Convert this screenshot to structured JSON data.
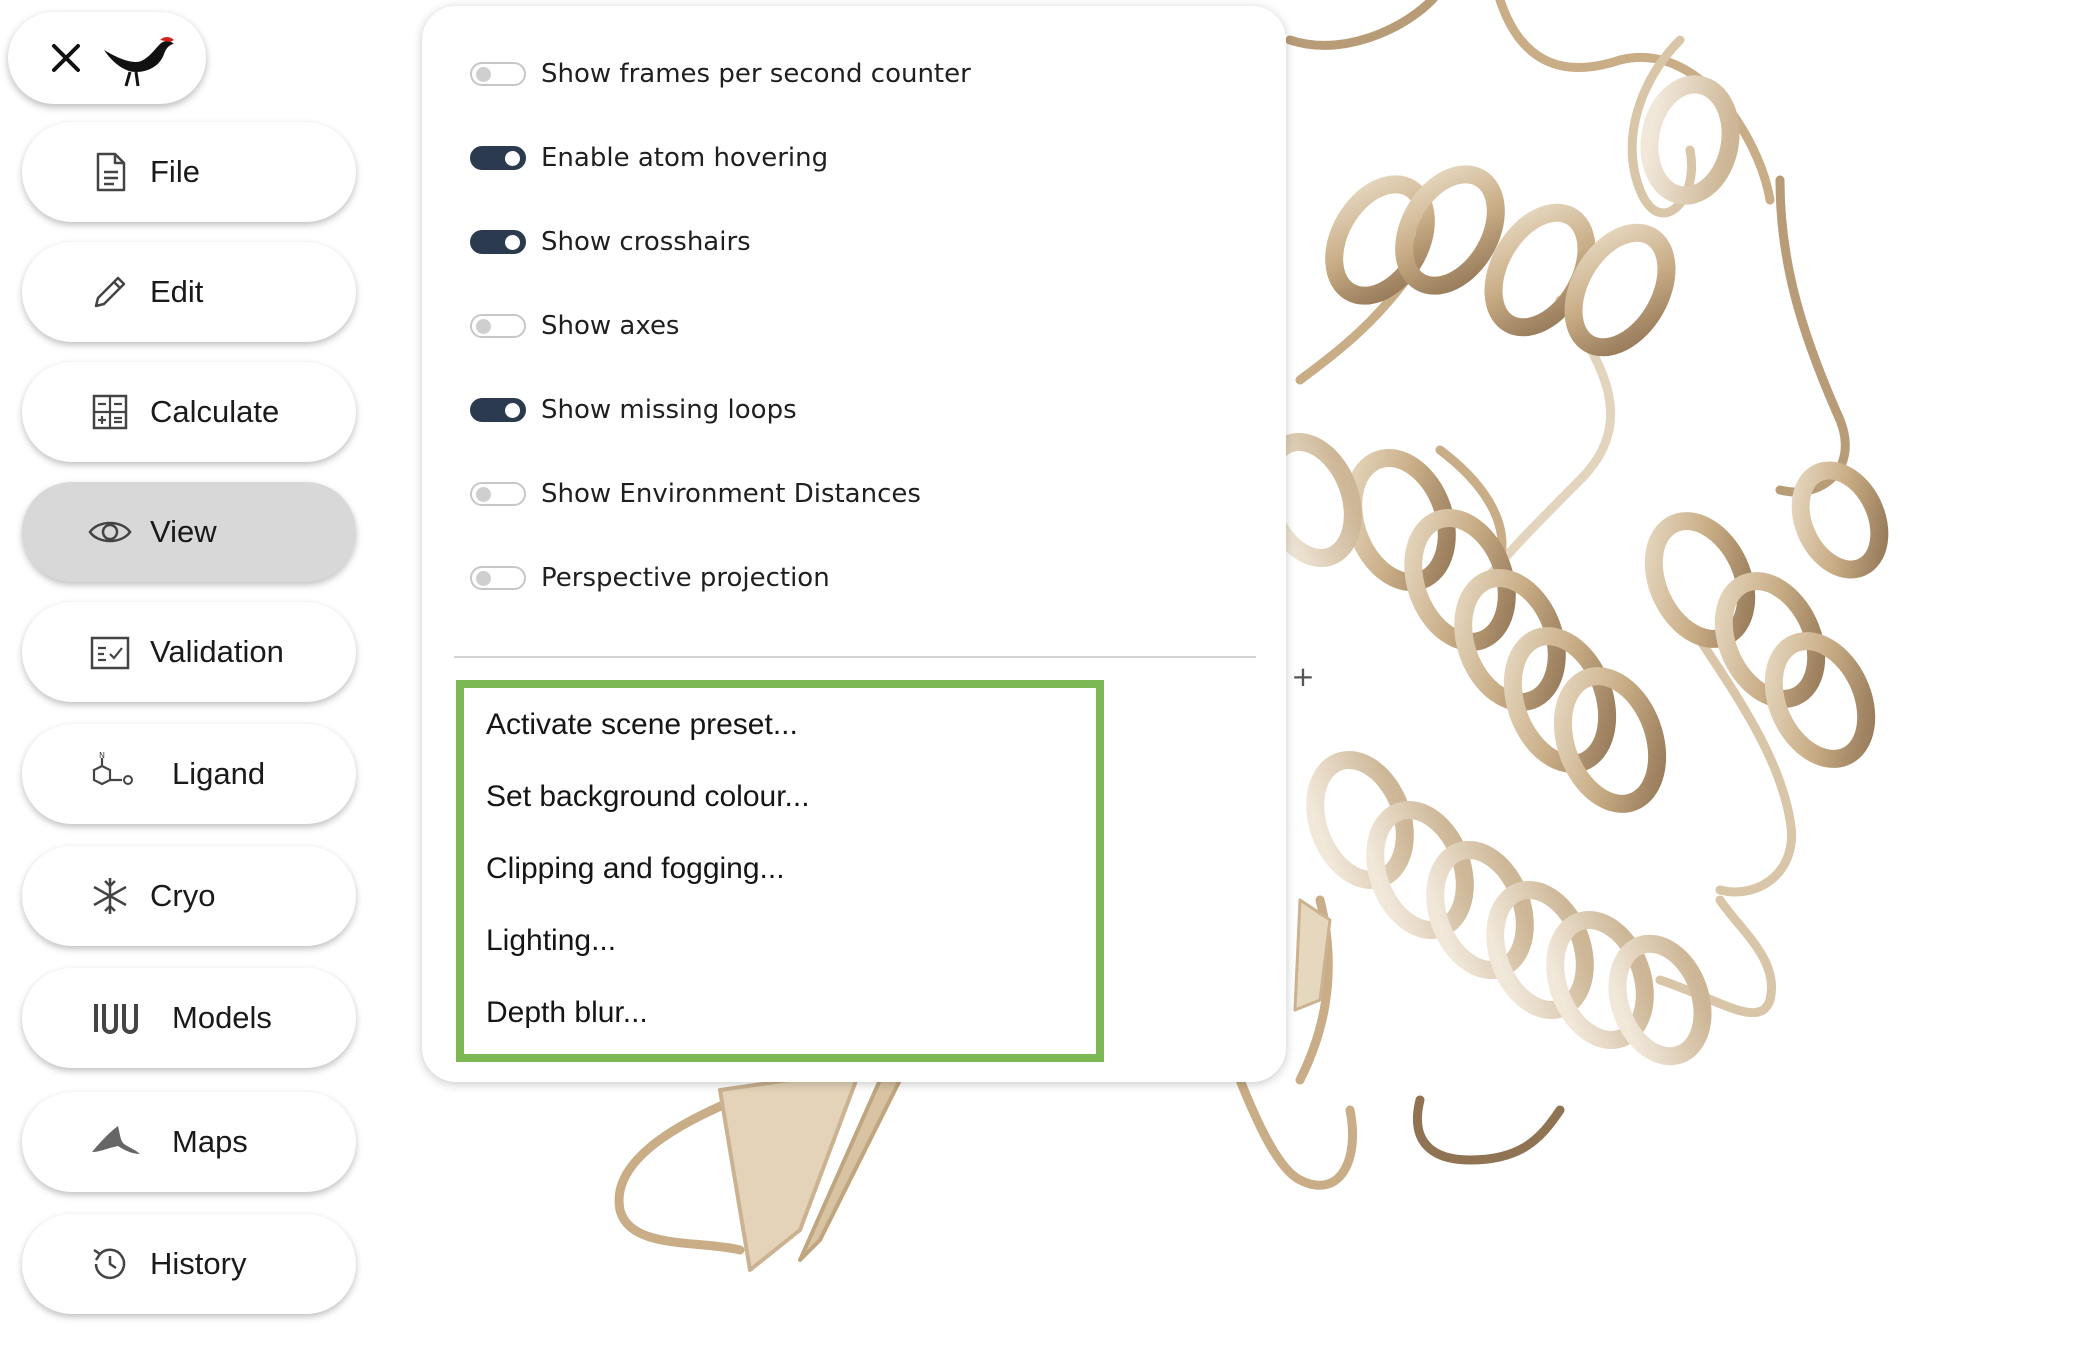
{
  "top_bar": {
    "close_icon": "close-icon",
    "logo_icon": "moorhen-bird-logo-icon"
  },
  "nav": {
    "items": [
      {
        "label": "File",
        "icon": "file-icon",
        "active": false
      },
      {
        "label": "Edit",
        "icon": "pencil-icon",
        "active": false
      },
      {
        "label": "Calculate",
        "icon": "calculator-icon",
        "active": false
      },
      {
        "label": "View",
        "icon": "eye-icon",
        "active": true
      },
      {
        "label": "Validation",
        "icon": "checklist-icon",
        "active": false
      },
      {
        "label": "Ligand",
        "icon": "molecule-icon",
        "active": false
      },
      {
        "label": "Cryo",
        "icon": "snowflake-icon",
        "active": false
      },
      {
        "label": "Models",
        "icon": "models-icon",
        "active": false
      },
      {
        "label": "Maps",
        "icon": "map-icon",
        "active": false
      },
      {
        "label": "History",
        "icon": "history-icon",
        "active": false
      }
    ]
  },
  "view_panel": {
    "toggles": [
      {
        "label": "Show frames per second counter",
        "checked": false
      },
      {
        "label": "Enable atom hovering",
        "checked": true
      },
      {
        "label": "Show crosshairs",
        "checked": true
      },
      {
        "label": "Show axes",
        "checked": false
      },
      {
        "label": "Show missing loops",
        "checked": true
      },
      {
        "label": "Show Environment Distances",
        "checked": false
      },
      {
        "label": "Perspective projection",
        "checked": false
      }
    ],
    "menu_items": [
      "Activate scene preset...",
      "Set background colour...",
      "Clipping and fogging...",
      "Lighting...",
      "Depth blur..."
    ]
  },
  "viewer": {
    "crosshair_glyph": "+"
  },
  "colors": {
    "toggle_on": "#2b3a4f",
    "highlight_border": "#7cb854",
    "active_nav": "#d8d8d8",
    "ribbon": "#c9ad86"
  }
}
